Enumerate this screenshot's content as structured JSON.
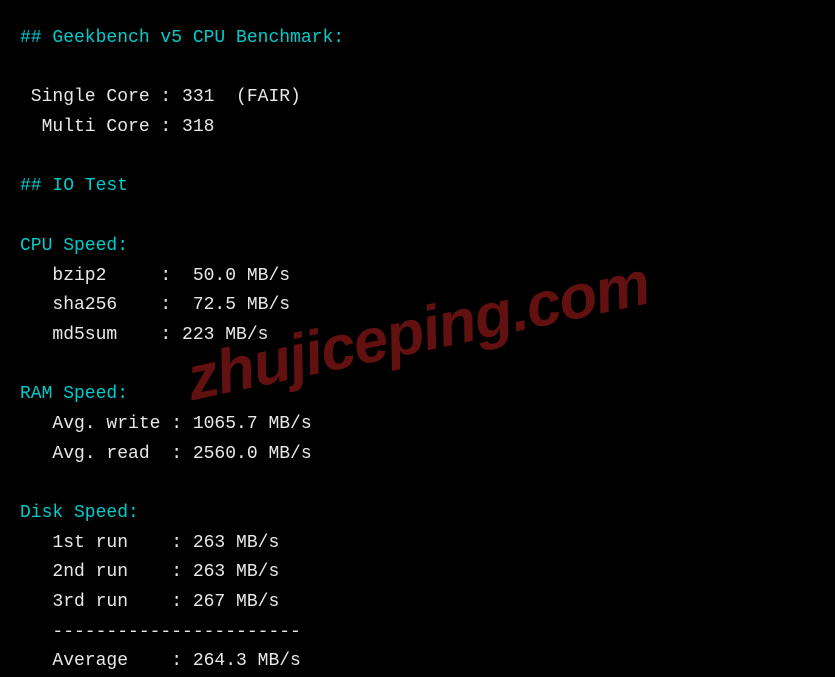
{
  "geekbench": {
    "header": "## Geekbench v5 CPU Benchmark:",
    "single_label": " Single Core : ",
    "single_value": "331  (FAIR)",
    "multi_label": "  Multi Core : ",
    "multi_value": "318"
  },
  "iotest": {
    "header": "## IO Test"
  },
  "cpu_speed": {
    "header": "CPU Speed:",
    "bzip2_label": "   bzip2     :  ",
    "bzip2_value": "50.0 MB/s",
    "sha256_label": "   sha256    :  ",
    "sha256_value": "72.5 MB/s",
    "md5sum_label": "   md5sum    : ",
    "md5sum_value": "223 MB/s"
  },
  "ram_speed": {
    "header": "RAM Speed:",
    "write_label": "   Avg. write : ",
    "write_value": "1065.7 MB/s",
    "read_label": "   Avg. read  : ",
    "read_value": "2560.0 MB/s"
  },
  "disk_speed": {
    "header": "Disk Speed:",
    "run1_label": "   1st run    : ",
    "run1_value": "263 MB/s",
    "run2_label": "   2nd run    : ",
    "run2_value": "263 MB/s",
    "run3_label": "   3rd run    : ",
    "run3_value": "267 MB/s",
    "divider": "   -----------------------",
    "avg_label": "   Average    : ",
    "avg_value": "264.3 MB/s"
  },
  "watermark": "zhujiceping.com"
}
